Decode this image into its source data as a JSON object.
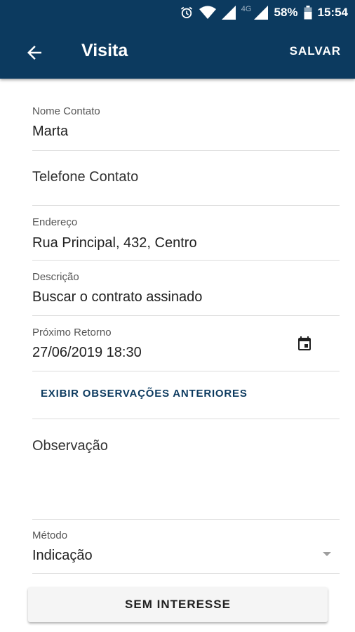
{
  "status_bar": {
    "network": "4G",
    "battery": "58%",
    "time": "15:54"
  },
  "app_bar": {
    "title": "Visita",
    "save_label": "SALVAR"
  },
  "fields": {
    "nome": {
      "label": "Nome Contato",
      "value": "Marta"
    },
    "telefone": {
      "placeholder": "Telefone Contato"
    },
    "endereco": {
      "label": "Endereço",
      "value": "Rua Principal, 432, Centro"
    },
    "descricao": {
      "label": "Descrição",
      "value": "Buscar o contrato assinado"
    },
    "retorno": {
      "label": "Próximo Retorno",
      "value": "27/06/2019 18:30"
    },
    "observacao": {
      "placeholder": "Observação"
    },
    "metodo": {
      "label": "Método",
      "value": "Indicação"
    }
  },
  "show_previous_label": "EXIBIR OBSERVAÇÕES ANTERIORES",
  "no_interest_label": "SEM INTERESSE",
  "colors": {
    "app_bar": "#0c3a5f",
    "accent": "#0c3a5f"
  }
}
